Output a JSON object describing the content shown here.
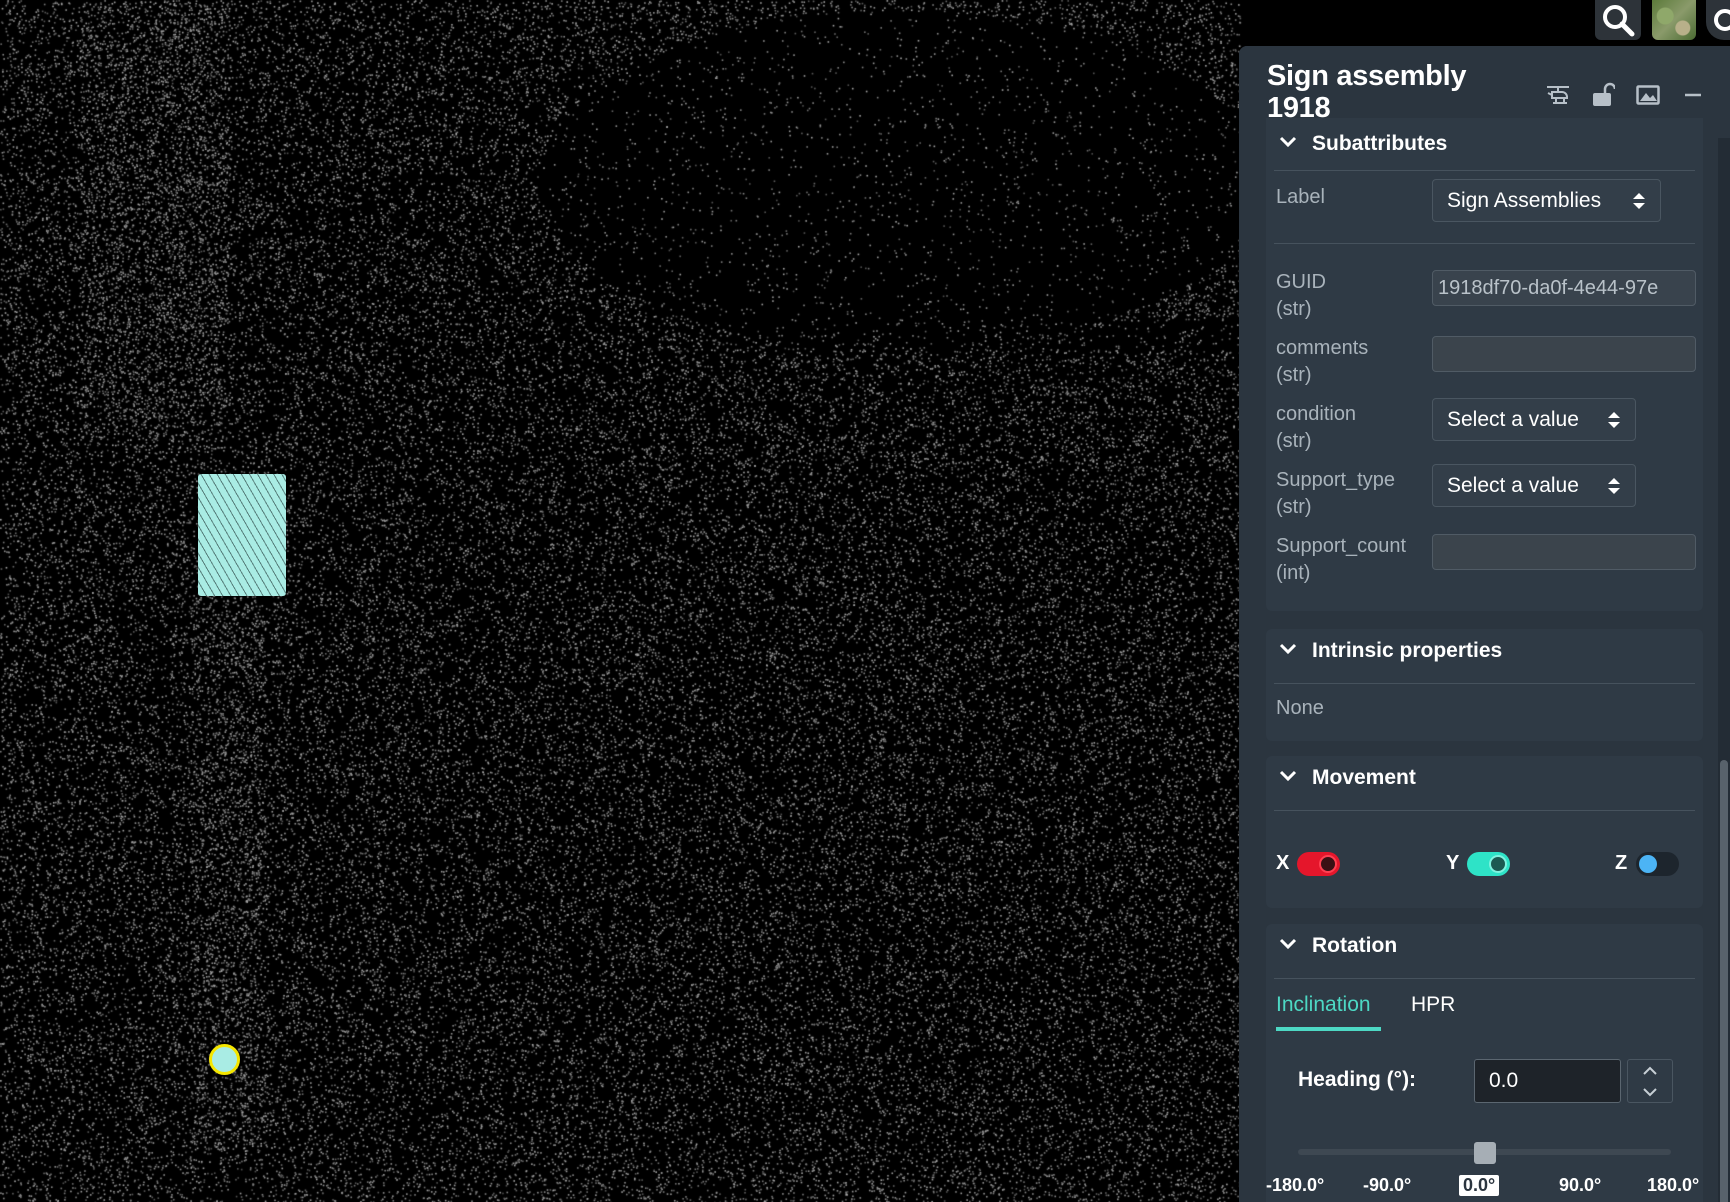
{
  "panel": {
    "title": "Sign assembly 1918",
    "header_icons": [
      "helicopter-icon",
      "unlock-icon",
      "image-icon",
      "minimize-icon",
      "close-icon"
    ]
  },
  "subattributes": {
    "title": "Subattributes",
    "label": {
      "name": "Label",
      "value": "Sign Assemblies"
    },
    "fields": [
      {
        "name": "GUID",
        "type": "(str)",
        "value": "1918df70-da0f-4e44-97e"
      },
      {
        "name": "comments",
        "type": "(str)",
        "value": ""
      },
      {
        "name": "condition",
        "type": "(str)",
        "value": "Select a value"
      },
      {
        "name": "Support_type",
        "type": "(str)",
        "value": "Select a value"
      },
      {
        "name": "Support_count",
        "type": "(int)",
        "value": ""
      }
    ]
  },
  "intrinsic": {
    "title": "Intrinsic properties",
    "value": "None"
  },
  "movement": {
    "title": "Movement",
    "axes": [
      {
        "label": "X",
        "on": true,
        "color": "#e5162b"
      },
      {
        "label": "Y",
        "on": true,
        "color": "#2ee3c7"
      },
      {
        "label": "Z",
        "on": false,
        "color": "#4cb4f5"
      }
    ]
  },
  "rotation": {
    "title": "Rotation",
    "tabs": [
      {
        "label": "Inclination",
        "active": true
      },
      {
        "label": "HPR",
        "active": false
      }
    ],
    "heading_label": "Heading (°):",
    "heading_value": "0.0",
    "slider_value": 0.0,
    "slider_ticks": [
      "-180.0°",
      "-90.0°",
      "0.0°",
      "90.0°",
      "180.0°"
    ]
  },
  "colors": {
    "accent": "#4dd8c4",
    "selection": "#a9ece4",
    "base_point_ring": "#f5e600"
  }
}
